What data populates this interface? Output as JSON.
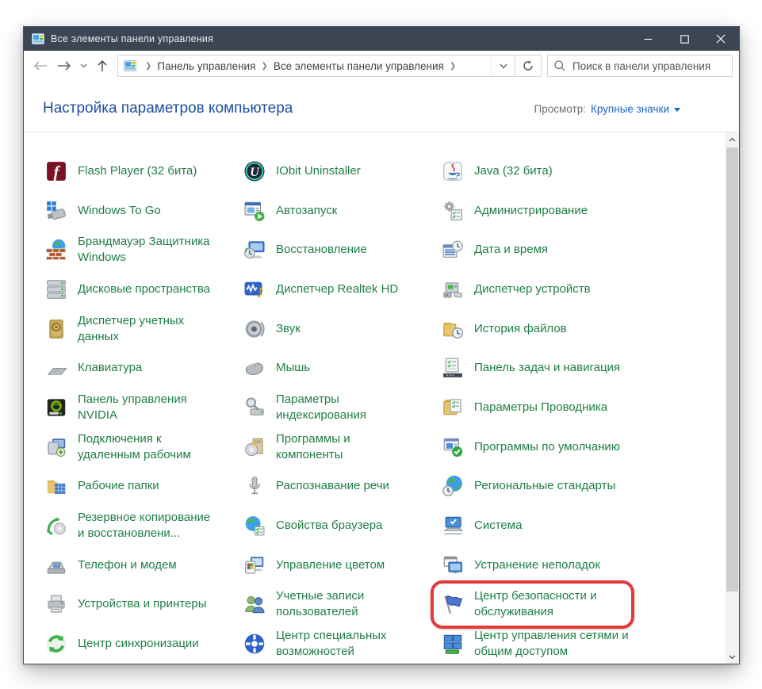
{
  "window": {
    "title": "Все элементы панели управления",
    "control_icons": [
      "minimize-icon",
      "maximize-icon",
      "close-icon"
    ]
  },
  "toolbar": {
    "nav_icons": [
      "back-arrow-icon",
      "forward-arrow-icon",
      "history-chevron-icon",
      "up-arrow-icon",
      "refresh-icon"
    ],
    "breadcrumb": [
      "Панель управления",
      "Все элементы панели управления"
    ],
    "search_placeholder": "Поиск в панели управления"
  },
  "header": {
    "title": "Настройка параметров компьютера",
    "view_label": "Просмотр:",
    "view_value": "Крупные значки"
  },
  "colors": {
    "titlebar": "#3c4553",
    "item_label_green": "#1f7f46",
    "header_blue": "#1e4fa0",
    "view_link_blue": "#1a66c2",
    "highlight_red": "#e23a3a"
  },
  "highlight": {
    "label": "Центр безопасности и обслуживания",
    "color": "#e23a3a"
  },
  "grid": {
    "columns": [
      {
        "items": [
          {
            "label": "Flash Player (32 бита)",
            "icon": "flash-player"
          },
          {
            "label": "Windows To Go",
            "icon": "windows-to-go"
          },
          {
            "label": "Брандмауэр Защитника Windows",
            "icon": "firewall"
          },
          {
            "label": "Дисковые пространства",
            "icon": "storage-spaces"
          },
          {
            "label": "Диспетчер учетных данных",
            "icon": "credential-manager"
          },
          {
            "label": "Клавиатура",
            "icon": "keyboard"
          },
          {
            "label": "Панель управления NVIDIA",
            "icon": "nvidia"
          },
          {
            "label": "Подключения к удаленным рабочим",
            "icon": "remote-desktop"
          },
          {
            "label": "Рабочие папки",
            "icon": "work-folders"
          },
          {
            "label": "Резервное копирование и восстановлени...",
            "icon": "backup-restore"
          },
          {
            "label": "Телефон и модем",
            "icon": "phone-modem"
          },
          {
            "label": "Устройства и принтеры",
            "icon": "devices-printers"
          },
          {
            "label": "Центр синхронизации",
            "icon": "sync-center"
          }
        ]
      },
      {
        "items": [
          {
            "label": "IObit Uninstaller",
            "icon": "iobit-uninstaller"
          },
          {
            "label": "Автозапуск",
            "icon": "autoplay"
          },
          {
            "label": "Восстановление",
            "icon": "recovery"
          },
          {
            "label": "Диспетчер Realtek HD",
            "icon": "realtek"
          },
          {
            "label": "Звук",
            "icon": "sound"
          },
          {
            "label": "Мышь",
            "icon": "mouse"
          },
          {
            "label": "Параметры индексирования",
            "icon": "indexing-options"
          },
          {
            "label": "Программы и компоненты",
            "icon": "programs-features"
          },
          {
            "label": "Распознавание речи",
            "icon": "speech-recognition"
          },
          {
            "label": "Свойства браузера",
            "icon": "internet-options"
          },
          {
            "label": "Управление цветом",
            "icon": "color-management"
          },
          {
            "label": "Учетные записи пользователей",
            "icon": "user-accounts"
          },
          {
            "label": "Центр специальных возможностей",
            "icon": "ease-of-access"
          }
        ]
      },
      {
        "items": [
          {
            "label": "Java (32 бита)",
            "icon": "java"
          },
          {
            "label": "Администрирование",
            "icon": "admin-tools"
          },
          {
            "label": "Дата и время",
            "icon": "date-time"
          },
          {
            "label": "Диспетчер устройств",
            "icon": "device-manager"
          },
          {
            "label": "История файлов",
            "icon": "file-history"
          },
          {
            "label": "Панель задач и навигация",
            "icon": "taskbar-navigation"
          },
          {
            "label": "Параметры Проводника",
            "icon": "explorer-options"
          },
          {
            "label": "Программы по умолчанию",
            "icon": "default-programs"
          },
          {
            "label": "Региональные стандарты",
            "icon": "regional-standards"
          },
          {
            "label": "Система",
            "icon": "system"
          },
          {
            "label": "Устранение неполадок",
            "icon": "troubleshooting"
          },
          {
            "label": "Центр безопасности и обслуживания",
            "icon": "security-maintenance",
            "highlighted": true
          },
          {
            "label": "Центр управления сетями и общим доступом",
            "icon": "network-sharing"
          }
        ]
      }
    ]
  }
}
